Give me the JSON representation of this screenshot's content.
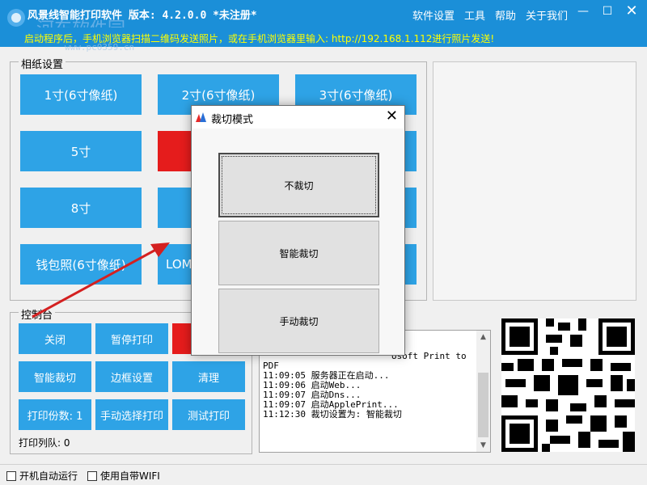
{
  "app": {
    "title": "风景线智能打印软件  版本: 4.2.0.0 *未注册*",
    "watermark": "河东软件园",
    "watermark_url": "www.pc0359.cn",
    "menu": [
      "软件设置",
      "工具",
      "帮助",
      "关于我们"
    ],
    "window_controls": {
      "minimize": "—",
      "maximize": "☐",
      "close": "✕"
    }
  },
  "info_bar": {
    "text": "启动程序后，手机浏览器扫描二维码发送照片，或在手机浏览器里输入: http://192.168.1.112进行照片发送!"
  },
  "paper_settings": {
    "legend": "相纸设置",
    "buttons": [
      "1寸(6寸像纸)",
      "2寸(6寸像纸)",
      "3寸(6寸像纸)",
      "5寸",
      "",
      "",
      "8寸",
      "",
      "",
      "钱包照(6寸像纸)",
      "LOMO",
      ""
    ]
  },
  "console": {
    "legend": "控制台",
    "buttons": [
      "关闭",
      "暂停打印",
      "",
      "智能裁切",
      "边框设置",
      "清理",
      "打印份数: 1",
      "手动选择打印",
      "测试打印"
    ],
    "queue_label": "打印列队: 0"
  },
  "log": {
    "lines": [
      "                        DF",
      "                        osoft Print to",
      "PDF",
      "11:09:05 服务器正在启动...",
      "11:09:06 启动Web...",
      "11:09:07 启动Dns...",
      "11:09:07 启动ApplePrint...",
      "11:12:30 裁切设置为: 智能裁切"
    ]
  },
  "bottom": {
    "autostart": "开机自动运行",
    "wifi": "使用自带WIFI"
  },
  "dialog": {
    "title": "裁切模式",
    "close": "✕",
    "options": [
      "不裁切",
      "智能裁切",
      "手动裁切"
    ]
  },
  "colors": {
    "titlebar": "#1b8fd8",
    "button": "#2ea3e6",
    "selected": "#e51c1c",
    "info_text": "#ffff00",
    "arrow": "#d42020"
  }
}
